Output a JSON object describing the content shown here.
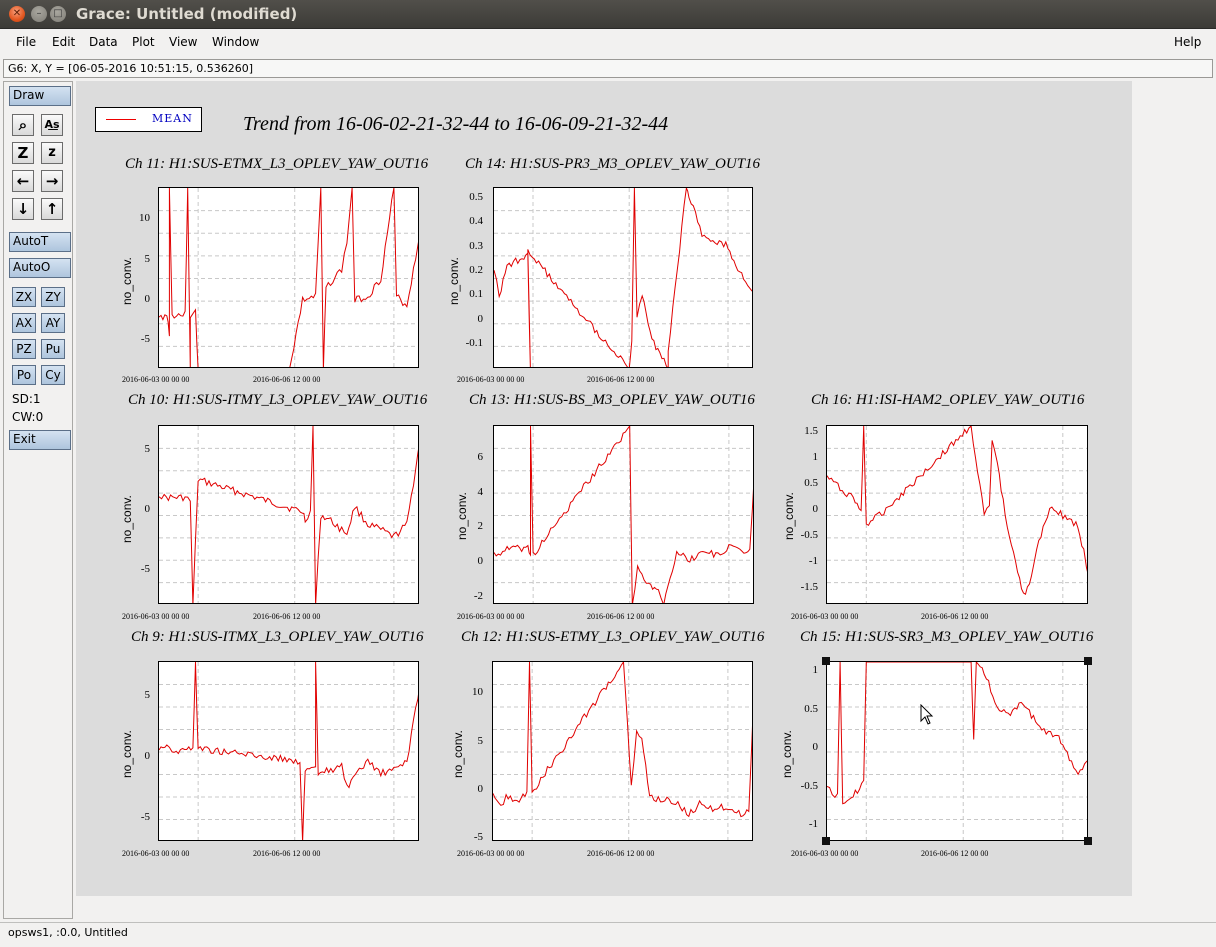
{
  "window": {
    "title": "Grace: Untitled (modified)"
  },
  "menu": {
    "file": "File",
    "edit": "Edit",
    "data": "Data",
    "plot": "Plot",
    "view": "View",
    "window": "Window",
    "help": "Help"
  },
  "coord": "G6: X, Y = [06-05-2016 10:51:15, 0.536260]",
  "tools": {
    "draw": "Draw",
    "zoom_icon": "magnifier-icon",
    "autot": "AutoT",
    "autoo": "AutoO",
    "zx": "ZX",
    "zy": "ZY",
    "ax": "AX",
    "ay": "AY",
    "pz": "PZ",
    "pu": "Pu",
    "po": "Po",
    "cy": "Cy",
    "sd": "SD:1",
    "cw": "CW:0",
    "exit": "Exit"
  },
  "status": "opsws1, :0.0, Untitled",
  "legend": {
    "label": "MEAN",
    "color": "#e00000"
  },
  "main_title": "Trend from 16-06-02-21-32-44 to 16-06-09-21-32-44",
  "ylabel": "no_conv.",
  "xtick1": "2016-06-03 00 00 00",
  "xtick2": "2016-06-06 12 00 00",
  "panels": [
    {
      "title": "Ch 11: H1:SUS-ETMX_L3_OPLEV_YAW_OUT16",
      "yticks": [
        "10",
        "5",
        "0",
        "-5"
      ]
    },
    {
      "title": "Ch 14: H1:SUS-PR3_M3_OPLEV_YAW_OUT16",
      "yticks": [
        "0.5",
        "0.4",
        "0.3",
        "0.2",
        "0.1",
        "0",
        "-0.1"
      ]
    },
    {
      "title": "Ch 10: H1:SUS-ITMY_L3_OPLEV_YAW_OUT16",
      "yticks": [
        "5",
        "0",
        "-5"
      ]
    },
    {
      "title": "Ch 13: H1:SUS-BS_M3_OPLEV_YAW_OUT16",
      "yticks": [
        "6",
        "4",
        "2",
        "0",
        "-2"
      ]
    },
    {
      "title": "Ch 16: H1:ISI-HAM2_OPLEV_YAW_OUT16",
      "yticks": [
        "1.5",
        "1",
        "0.5",
        "0",
        "-0.5",
        "-1",
        "-1.5"
      ]
    },
    {
      "title": "Ch 9: H1:SUS-ITMX_L3_OPLEV_YAW_OUT16",
      "yticks": [
        "5",
        "0",
        "-5"
      ]
    },
    {
      "title": "Ch 12: H1:SUS-ETMY_L3_OPLEV_YAW_OUT16",
      "yticks": [
        "10",
        "5",
        "0",
        "-5"
      ]
    },
    {
      "title": "Ch 15: H1:SUS-SR3_M3_OPLEV_YAW_OUT16",
      "yticks": [
        "1",
        "0.5",
        "0",
        "-0.5",
        "-1"
      ]
    }
  ]
}
